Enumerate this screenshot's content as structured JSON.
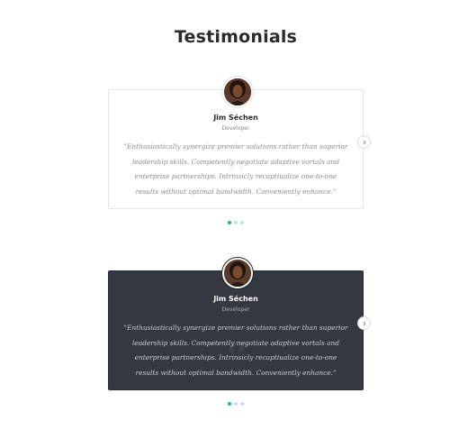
{
  "section": {
    "title": "Testimonials"
  },
  "testimonials": [
    {
      "theme": "light",
      "name": "Jim Séchen",
      "role": "Developer",
      "quote": "\"Enthusiastically synergize premier solutions rather than superior leadership skills. Competently negotiate adaptive vortals and enterprise partnerships. Intrinsicly recaptiualize one-to-one results without optimal bandwidth. Conveniently enhance.\"",
      "avatar_icon": "person-portrait-icon",
      "next_icon": "chevron-right-icon",
      "pagination": {
        "count": 3,
        "active_index": 0
      }
    },
    {
      "theme": "dark",
      "name": "Jim Séchen",
      "role": "Developer",
      "quote": "\"Enthusiastically synergize premier solutions rather than superior leadership skills. Competently negotiate adaptive vortals and enterprise partnerships. Intrinsicly recaptiualize one-to-one results without optimal bandwidth. Conveniently enhance.\"",
      "avatar_icon": "person-portrait-icon",
      "next_icon": "chevron-right-icon",
      "pagination": {
        "count": 3,
        "active_index": 0
      }
    }
  ],
  "colors": {
    "accent": "#2aa7a9",
    "accent_light": "#bfe3e4",
    "dark_card_bg": "#343841",
    "title_text": "#2b2b2b"
  }
}
